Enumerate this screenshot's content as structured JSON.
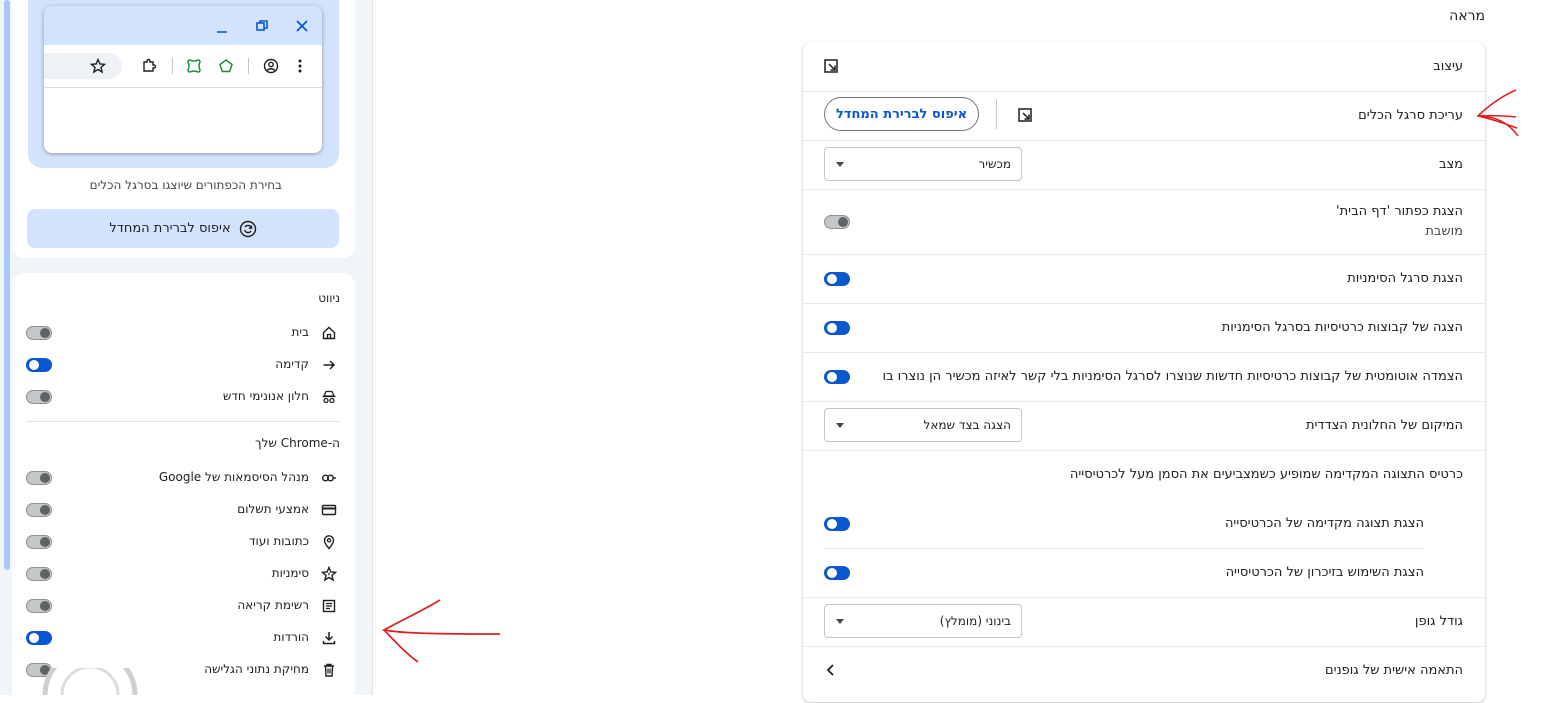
{
  "left_panel": {
    "customize_caption": "בחירת הכפתורים שיוצגו בסרגל הכלים",
    "reset_label": "איפוס לברירת המחדל",
    "navigation": {
      "title": "ניווט",
      "items": [
        {
          "label": "בית",
          "icon": "home-icon",
          "on": false
        },
        {
          "label": "קדימה",
          "icon": "forward-arrow-icon",
          "on": true
        },
        {
          "label": "חלון אנונימי חדש",
          "icon": "incognito-icon",
          "on": false
        }
      ]
    },
    "your_chrome": {
      "title": "ה-Chrome שלך",
      "items": [
        {
          "label": "מנהל הסיסמאות של Google",
          "icon": "key-icon",
          "on": false
        },
        {
          "label": "אמצעי תשלום",
          "icon": "credit-card-icon",
          "on": false
        },
        {
          "label": "כתובות ועוד",
          "icon": "location-pin-icon",
          "on": false
        },
        {
          "label": "סימניות",
          "icon": "star-bookmark-icon",
          "on": false
        },
        {
          "label": "רשימת קריאה",
          "icon": "reading-list-icon",
          "on": false
        },
        {
          "label": "הורדות",
          "icon": "download-icon",
          "on": true
        },
        {
          "label": "מחיקת נתוני הגלישה",
          "icon": "trash-icon",
          "on": false
        }
      ]
    }
  },
  "appearance": {
    "title": "מראה",
    "rows": {
      "design": "עיצוב",
      "edit_toolbar": "עריכת סרגל הכלים",
      "reset_label": "איפוס לברירת המחדל",
      "mode_label": "מצב",
      "mode_value": "מכשיר",
      "home_button_label": "הצגת כפתור 'דף הבית'",
      "home_button_sub": "מושבת",
      "bookmarks_bar": "הצגת סרגל הסימניות",
      "tab_groups_bookmarks": "הצגה של קבוצות כרטיסיות בסרגל הסימניות",
      "auto_pin_groups": "הצמדה אוטומטית של קבוצות כרטיסיות חדשות שנוצרו לסרגל הסימניות בלי קשר לאיזה מכשיר הן נוצרו בו",
      "side_panel_label": "המיקום של החלונית הצדדית",
      "side_panel_value": "הצגה בצד שמאל",
      "hover_card_title": "כרטיס התצוגה המקדימה שמופיע כשמצביעים את הסמן מעל לכרטיסייה",
      "tab_preview": "הצגת תצוגה מקדימה של הכרטיסייה",
      "tab_memory": "הצגת השימוש בזיכרון של הכרטיסייה",
      "font_size_label": "גודל גופן",
      "font_size_value": "בינוני (מומלץ)",
      "customize_fonts": "התאמה אישית של גופנים"
    },
    "toggles": {
      "home_button": false,
      "bookmarks_bar": true,
      "tab_groups_bookmarks": true,
      "auto_pin_groups": true,
      "tab_preview": true,
      "tab_memory": true
    }
  },
  "colors": {
    "accent": "#0b57d0",
    "light_blue": "#d3e3fd",
    "annotation_red": "#e02020",
    "extension_green": "#1e8e3e"
  }
}
